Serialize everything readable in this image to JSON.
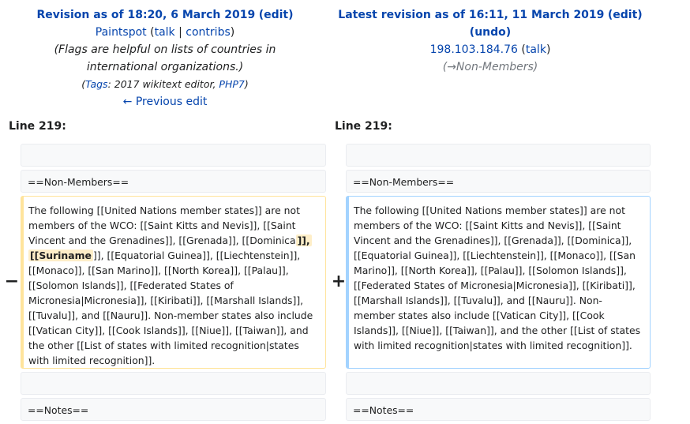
{
  "left": {
    "title": "Revision as of 18:20, 6 March 2019",
    "edit": "edit",
    "user": "Paintspot",
    "talk": "talk",
    "contribs": "contribs",
    "summary": "(Flags are helpful on lists of countries in international organizations.)",
    "tags_label": "Tags",
    "tag1": "2017 wikitext editor",
    "tag2": "PHP7",
    "prev": "← Previous edit",
    "line": "Line 219:"
  },
  "right": {
    "title": "Latest revision as of 16:11, 11 March 2019",
    "edit": "edit",
    "undo": "undo",
    "user": "198.103.184.76",
    "talk": "talk",
    "summary": "→Non-Members",
    "line": "Line 219:"
  },
  "diff": {
    "heading1": "==Non-Members==",
    "heading2": "==Notes==",
    "minus": "−",
    "plus": "+",
    "old_a": "The following [[United Nations member states]] are not members of the WCO: [[Saint Kitts and Nevis]], [[Saint Vincent and the Grenadines]], [[Grenada]], [[Dominica",
    "old_mark1": "]],",
    "old_mark2": "[[Suriname",
    "old_b": "]], [[Equatorial Guinea]], [[Liechtenstein]], [[Monaco]], [[San Marino]], [[North Korea]], [[Palau]], [[Solomon Islands]], [[Federated States of Micronesia|Micronesia]], [[Kiribati]], [[Marshall Islands]], [[Tuvalu]], and [[Nauru]]. Non-member states also include [[Vatican City]], [[Cook Islands]], [[Niue]], [[Taiwan]], and the other [[List of states with limited recognition|states with limited recognition]].",
    "new": "The following [[United Nations member states]] are not members of the WCO: [[Saint Kitts and Nevis]], [[Saint Vincent and the Grenadines]], [[Grenada]], [[Dominica]], [[Equatorial Guinea]], [[Liechtenstein]], [[Monaco]], [[San Marino]], [[North Korea]], [[Palau]], [[Solomon Islands]], [[Federated States of Micronesia|Micronesia]], [[Kiribati]], [[Marshall Islands]], [[Tuvalu]], and [[Nauru]]. Non-member states also include [[Vatican City]], [[Cook Islands]], [[Niue]], [[Taiwan]], and the other [[List of states with limited recognition|states with limited recognition]]."
  }
}
